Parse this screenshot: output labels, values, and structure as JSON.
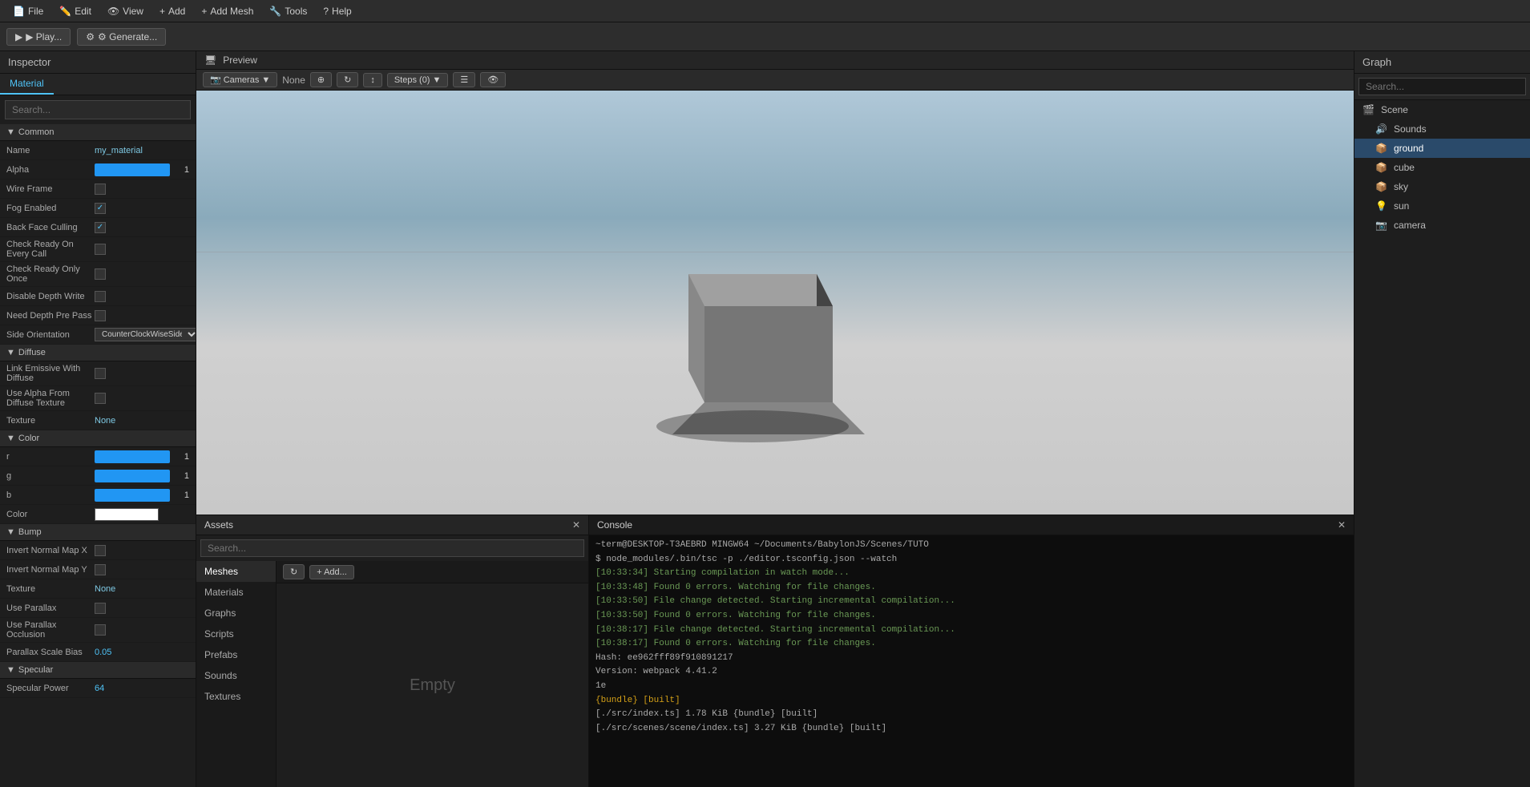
{
  "menubar": {
    "items": [
      {
        "label": "File",
        "icon": "file-icon"
      },
      {
        "label": "Edit",
        "icon": "edit-icon"
      },
      {
        "label": "View",
        "icon": "view-icon"
      },
      {
        "label": "Add",
        "icon": "add-icon"
      },
      {
        "label": "Add Mesh",
        "icon": "mesh-icon"
      },
      {
        "label": "Tools",
        "icon": "tools-icon"
      },
      {
        "label": "Help",
        "icon": "help-icon"
      }
    ]
  },
  "toolbar": {
    "play_label": "▶ Play...",
    "generate_label": "⚙ Generate..."
  },
  "inspector": {
    "title": "Inspector",
    "tab_material": "Material",
    "search_placeholder": "Search...",
    "sections": {
      "common": {
        "label": "Common",
        "props": [
          {
            "name": "Name",
            "value": "my_material",
            "type": "text"
          },
          {
            "name": "Alpha",
            "value": "1",
            "type": "slider"
          },
          {
            "name": "Wire Frame",
            "value": "",
            "type": "checkbox",
            "checked": false
          },
          {
            "name": "Fog Enabled",
            "value": "",
            "type": "checkbox",
            "checked": true
          },
          {
            "name": "Back Face Culling",
            "value": "",
            "type": "checkbox",
            "checked": true
          },
          {
            "name": "Check Ready On Every Call",
            "value": "",
            "type": "checkbox",
            "checked": false
          },
          {
            "name": "Check Ready Only Once",
            "value": "",
            "type": "checkbox",
            "checked": false
          },
          {
            "name": "Disable Depth Write",
            "value": "",
            "type": "checkbox",
            "checked": false
          },
          {
            "name": "Need Depth Pre Pass",
            "value": "",
            "type": "checkbox",
            "checked": false
          },
          {
            "name": "Side Orientation",
            "value": "CounterClockWiseSideOrient",
            "type": "select"
          }
        ]
      },
      "diffuse": {
        "label": "Diffuse",
        "props": [
          {
            "name": "Link Emissive With Diffuse",
            "value": "",
            "type": "checkbox",
            "checked": false
          },
          {
            "name": "Use Alpha From Diffuse Texture",
            "value": "",
            "type": "checkbox",
            "checked": false
          },
          {
            "name": "Texture",
            "value": "None",
            "type": "none"
          }
        ]
      },
      "color": {
        "label": "Color",
        "props": [
          {
            "name": "r",
            "value": "1",
            "type": "slider"
          },
          {
            "name": "g",
            "value": "1",
            "type": "slider"
          },
          {
            "name": "b",
            "value": "1",
            "type": "slider"
          },
          {
            "name": "Color",
            "value": "#ffffff",
            "type": "color"
          }
        ]
      },
      "bump": {
        "label": "Bump",
        "props": [
          {
            "name": "Invert Normal Map X",
            "value": "",
            "type": "checkbox",
            "checked": false
          },
          {
            "name": "Invert Normal Map Y",
            "value": "",
            "type": "checkbox",
            "checked": false
          },
          {
            "name": "Texture",
            "value": "None",
            "type": "none"
          },
          {
            "name": "Use Parallax",
            "value": "",
            "type": "checkbox",
            "checked": false
          },
          {
            "name": "Use Parallax Occlusion",
            "value": "",
            "type": "checkbox",
            "checked": false
          },
          {
            "name": "Parallax Scale Bias",
            "value": "0.05",
            "type": "smalltext"
          }
        ]
      },
      "specular": {
        "label": "Specular",
        "props": [
          {
            "name": "Specular Power",
            "value": "64",
            "type": "smalltext"
          }
        ]
      }
    }
  },
  "preview": {
    "title": "Preview",
    "camera_label": "Cameras",
    "none_label": "None",
    "steps_label": "Steps (0)"
  },
  "assets": {
    "title": "Assets",
    "search_placeholder": "Search...",
    "nav_items": [
      {
        "label": "Meshes",
        "active": true
      },
      {
        "label": "Materials"
      },
      {
        "label": "Graphs"
      },
      {
        "label": "Scripts"
      },
      {
        "label": "Prefabs"
      },
      {
        "label": "Sounds"
      },
      {
        "label": "Textures"
      }
    ],
    "empty_label": "Empty",
    "add_label": "+ Add...",
    "refresh_label": "↻"
  },
  "console": {
    "title": "Console",
    "lines": [
      {
        "text": "~term@DESKTOP-T3AEBRD MINGW64 ~/Documents/BabylonJS/Scenes/TUTO",
        "class": ""
      },
      {
        "text": "$ node_modules/.bin/tsc -p ./editor.tsconfig.json --watch",
        "class": ""
      },
      {
        "text": "[10:33:34] Starting compilation in watch mode...",
        "class": "ts"
      },
      {
        "text": "[10:33:48] Found 0 errors. Watching for file changes.",
        "class": "ts"
      },
      {
        "text": "[10:33:50] File change detected. Starting incremental compilation...",
        "class": "ts"
      },
      {
        "text": "[10:33:50] Found 0 errors. Watching for file changes.",
        "class": "ts"
      },
      {
        "text": "[10:38:17] File change detected. Starting incremental compilation...",
        "class": "ts"
      },
      {
        "text": "[10:38:17] Found 0 errors. Watching for file changes.",
        "class": "ts"
      },
      {
        "text": "",
        "class": ""
      },
      {
        "text": "Hash: ee962fff89f910891217",
        "class": ""
      },
      {
        "text": "Version: webpack 4.41.2",
        "class": ""
      },
      {
        "text": "",
        "class": ""
      },
      {
        "text": "1e",
        "class": ""
      },
      {
        "text": "{bundle} [built]",
        "class": "yellow"
      },
      {
        "text": "[./src/index.ts] 1.78 KiB {bundle} [built]",
        "class": ""
      },
      {
        "text": "[./src/scenes/scene/index.ts] 3.27 KiB {bundle} [built]",
        "class": ""
      }
    ]
  },
  "graph": {
    "title": "Graph",
    "search_placeholder": "Search...",
    "items": [
      {
        "label": "Scene",
        "icon": "scene",
        "indent": 0
      },
      {
        "label": "Sounds",
        "icon": "sound",
        "indent": 1
      },
      {
        "label": "ground",
        "icon": "mesh",
        "indent": 1,
        "active": true
      },
      {
        "label": "cube",
        "icon": "mesh",
        "indent": 1
      },
      {
        "label": "sky",
        "icon": "mesh",
        "indent": 1
      },
      {
        "label": "sun",
        "icon": "light",
        "indent": 1
      },
      {
        "label": "camera",
        "icon": "camera",
        "indent": 1
      }
    ]
  }
}
